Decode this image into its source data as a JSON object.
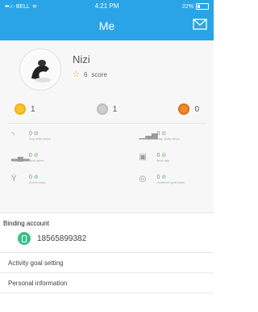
{
  "status_bar": {
    "carrier": "BELL",
    "signal_dots": "•••○○",
    "time": "4:21 PM",
    "battery": "22%"
  },
  "header": {
    "title": "Me",
    "mail_icon": "envelope-icon"
  },
  "profile": {
    "name": "Nizi",
    "score_value": "6",
    "score_label": "score",
    "star_icon": "star-icon",
    "avatar_icon": "avatar-image"
  },
  "medals": [
    {
      "type": "gold",
      "count": "1"
    },
    {
      "type": "silver",
      "count": "1"
    },
    {
      "type": "bronze",
      "count": "0"
    }
  ],
  "stats": [
    {
      "value": "0",
      "label": "Any daily steps"
    },
    {
      "value": "0",
      "label": "Avg. Daily steps"
    },
    {
      "value": "0",
      "label": "Best week"
    },
    {
      "value": "0",
      "label": "Best day"
    },
    {
      "value": "0",
      "label": "Active days"
    },
    {
      "value": "0",
      "label": "achieved goal days"
    }
  ],
  "binding": {
    "title": "Binding account",
    "phone": "18565899382"
  },
  "menu": [
    {
      "label": "Activity goal setting"
    },
    {
      "label": "Personal information"
    },
    {
      "label": ""
    }
  ],
  "colors": {
    "header": "#2aa4e6",
    "gold": "#f7c431",
    "silver": "#cfcfcf",
    "bronze": "#f08a2a",
    "binding_badge": "#3bbf8a"
  }
}
